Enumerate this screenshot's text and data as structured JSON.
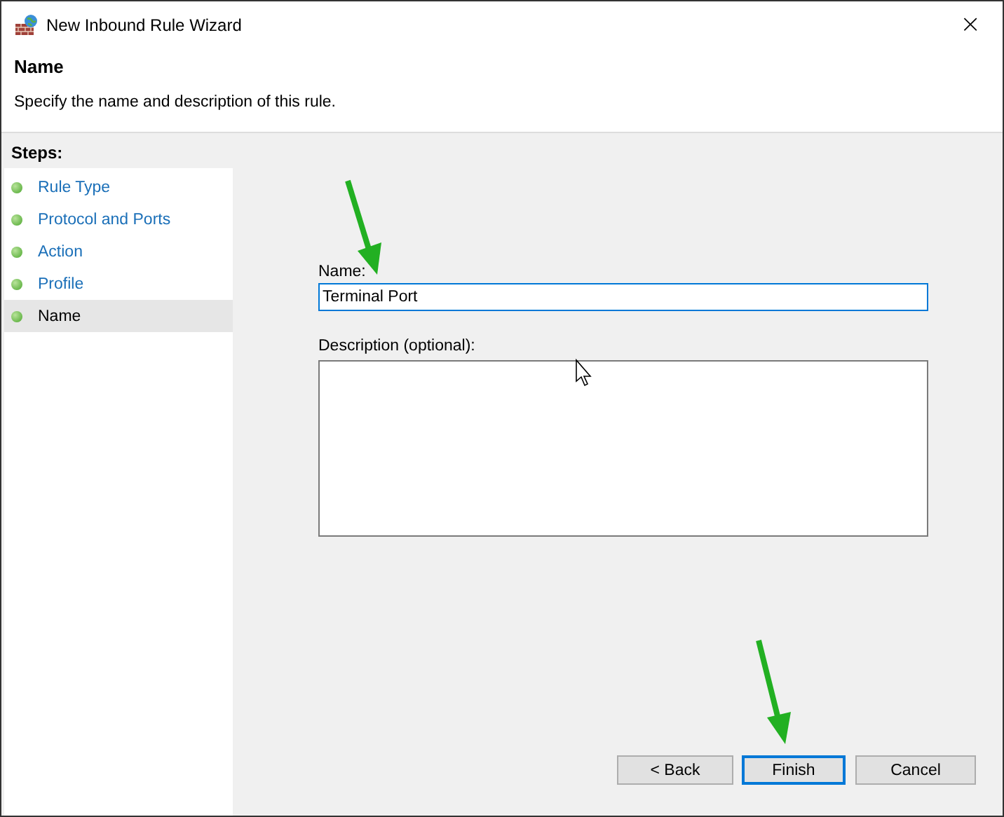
{
  "window": {
    "title": "New Inbound Rule Wizard",
    "close": "×"
  },
  "header": {
    "title": "Name",
    "subtitle": "Specify the name and description of this rule."
  },
  "steps": {
    "heading": "Steps:",
    "items": [
      {
        "label": "Rule Type",
        "selected": false
      },
      {
        "label": "Protocol and Ports",
        "selected": false
      },
      {
        "label": "Action",
        "selected": false
      },
      {
        "label": "Profile",
        "selected": false
      },
      {
        "label": "Name",
        "selected": true
      }
    ]
  },
  "form": {
    "name_label": "Name:",
    "name_value": "Terminal Port",
    "name_focused": true,
    "description_label": "Description (optional):"
  },
  "buttons": [
    {
      "label": "< Back",
      "default": false
    },
    {
      "label": "Finish",
      "default": true
    },
    {
      "label": "Cancel",
      "default": false
    }
  ]
}
